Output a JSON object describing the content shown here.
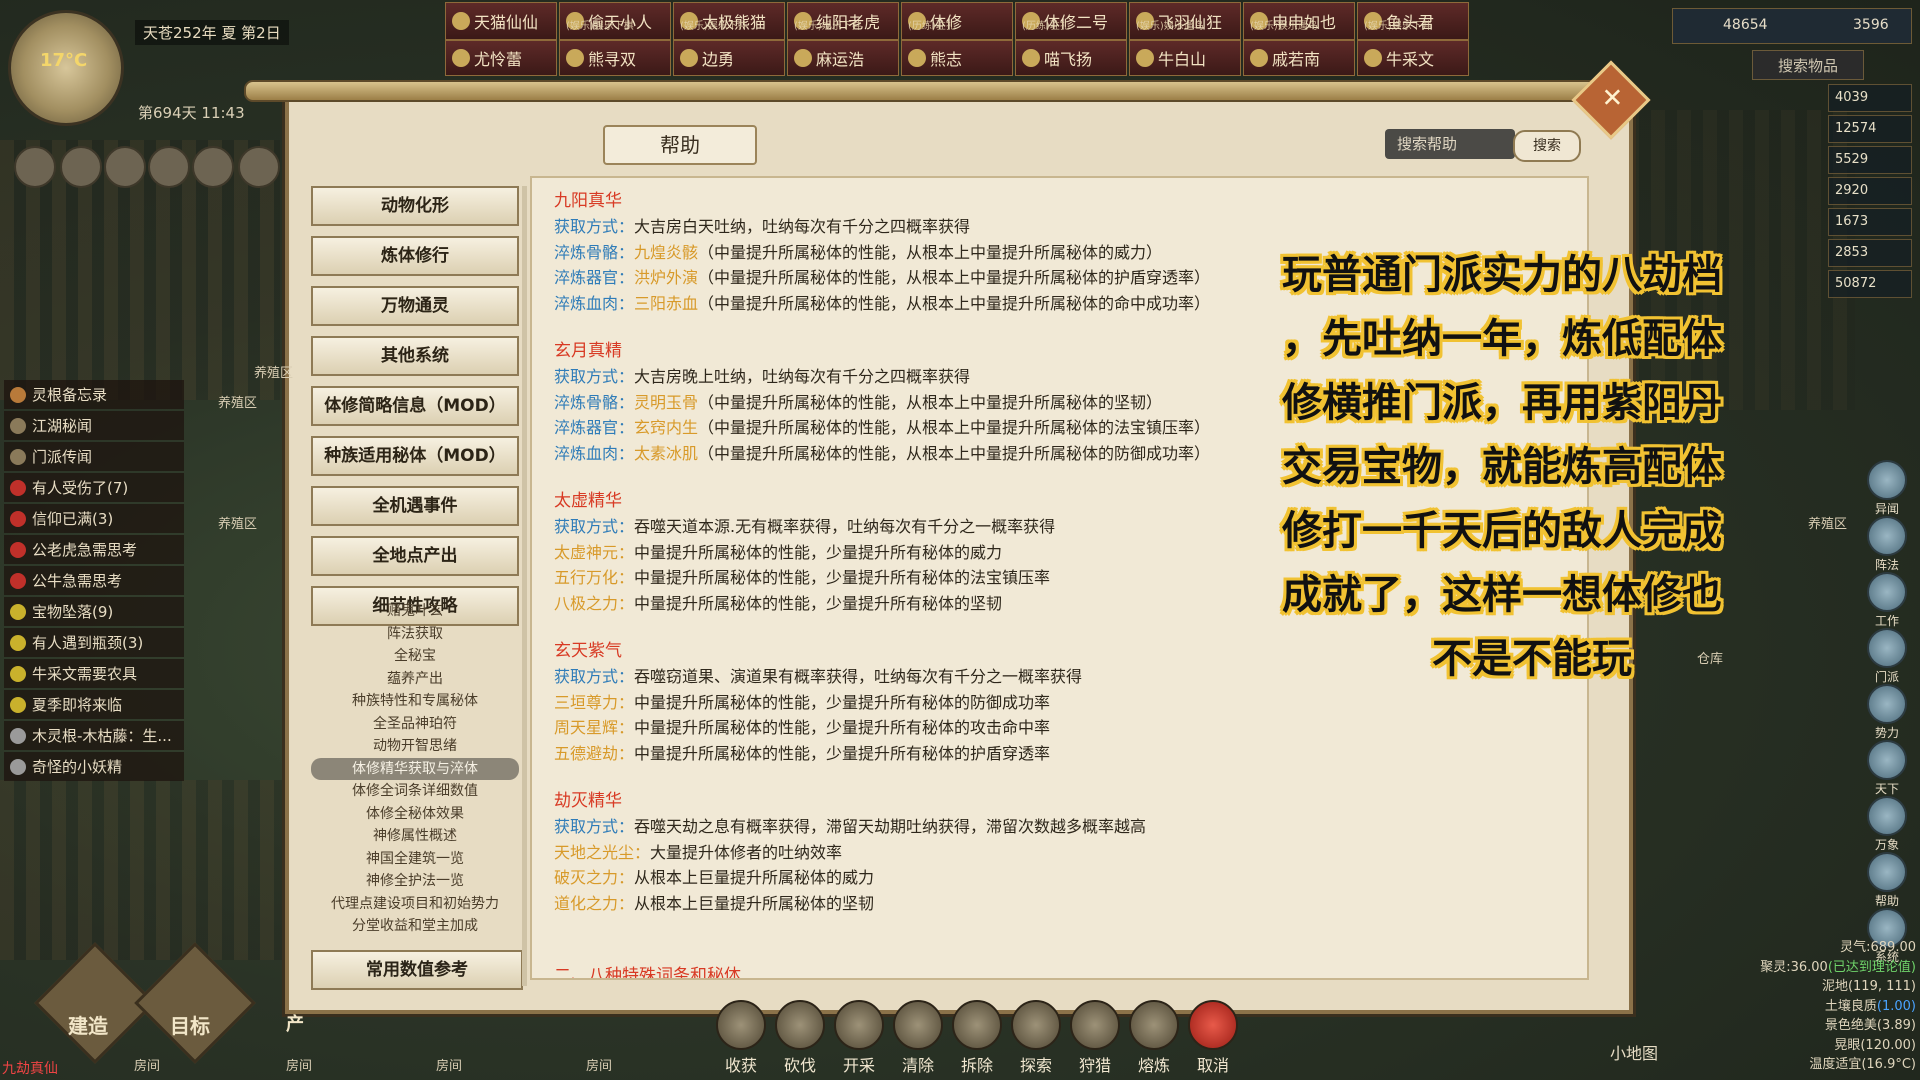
{
  "top": {
    "year_season": "天苍252年 夏 第2日",
    "temperature": "17°C",
    "day_time": "第694天 11:43",
    "npcs_row1": [
      {
        "name": "天猫仙仙",
        "sub": ""
      },
      {
        "name": "偷天小人",
        "sub": "(娱乐)娱乐下棋"
      },
      {
        "name": "太极熊猫",
        "sub": "(娱乐)娱乐下井"
      },
      {
        "name": "纯阳老虎",
        "sub": "(娱乐)娱乐下井"
      },
      {
        "name": "体修",
        "sub": "(历练)驻扎"
      },
      {
        "name": "体修二号",
        "sub": "(历练)驻扎"
      },
      {
        "name": "飞羽仙狂",
        "sub": "(娱乐)娱乐遛鸟"
      },
      {
        "name": "申申如也",
        "sub": "(娱乐)娱乐遛鸟"
      },
      {
        "name": "鱼头君",
        "sub": "(娱乐)娱乐下井"
      }
    ],
    "npcs_row2": [
      "尤怜蕾",
      "熊寻双",
      "边勇",
      "麻运浩",
      "熊志",
      "喵飞扬",
      "牛白山",
      "戚若南",
      "牛采文"
    ],
    "resources": {
      "spirit_stone": "48654",
      "food": "3596"
    },
    "search_items": "搜索物品",
    "res_values": [
      "4039",
      "12574",
      "5529",
      "2920",
      "1673",
      "2853",
      "50872"
    ]
  },
  "left_list": [
    {
      "label": "灵根备忘录",
      "dot": "#b87a3a"
    },
    {
      "label": "江湖秘闻",
      "dot": "#8a7a5a"
    },
    {
      "label": "门派传闻",
      "dot": "#8a7a5a"
    },
    {
      "label": "有人受伤了(7)",
      "dot": "#c0302a"
    },
    {
      "label": "信仰已满(3)",
      "dot": "#c0302a"
    },
    {
      "label": "公老虎急需思考",
      "dot": "#c0302a"
    },
    {
      "label": "公牛急需思考",
      "dot": "#c0302a"
    },
    {
      "label": "宝物坠落(9)",
      "dot": "#c9b12c"
    },
    {
      "label": "有人遇到瓶颈(3)",
      "dot": "#c9b12c"
    },
    {
      "label": "牛采文需要农具",
      "dot": "#c9b12c"
    },
    {
      "label": "夏季即将来临",
      "dot": "#c9b12c"
    },
    {
      "label": "木灵根-木枯藤：生...",
      "dot": "#9a9a9a"
    },
    {
      "label": "奇怪的小妖精",
      "dot": "#9a9a9a"
    }
  ],
  "panel": {
    "title": "帮助",
    "search_placeholder": "搜索帮助",
    "search_button": "搜索",
    "categories": [
      "动物化形",
      "炼体修行",
      "万物通灵",
      "其他系统",
      "体修简略信息（MOD）",
      "种族适用秘体（MOD）",
      "全机遇事件",
      "全地点产出",
      "细节性攻略"
    ],
    "subcategories": [
      "赌鬼叶玄",
      "阵法获取",
      "全秘宝",
      "蕴养产出",
      "种族特性和专属秘体",
      "全圣品神珀符",
      "动物开智思绪",
      "体修精华获取与淬体",
      "体修全词条详细数值",
      "体修全秘体效果",
      "神修属性概述",
      "神国全建筑一览",
      "神修全护法一览",
      "代理点建设项目和初始势力",
      "分堂收益和堂主加成"
    ],
    "active_sub_index": 7,
    "bottom_category": "常用数值参考",
    "sections": [
      {
        "title": "九阳真华",
        "rows": [
          {
            "k": "获取方式：",
            "o": "",
            "t": "大吉房白天吐纳，吐纳每次有千分之四概率获得"
          },
          {
            "k": "淬炼骨骼：",
            "o": "九煌炎骸",
            "t": "（中量提升所属秘体的性能，从根本上中量提升所属秘体的威力）"
          },
          {
            "k": "淬炼器官：",
            "o": "洪炉外演",
            "t": "（中量提升所属秘体的性能，从根本上中量提升所属秘体的护盾穿透率）"
          },
          {
            "k": "淬炼血肉：",
            "o": "三阳赤血",
            "t": "（中量提升所属秘体的性能，从根本上中量提升所属秘体的命中成功率）"
          }
        ]
      },
      {
        "title": "玄月真精",
        "rows": [
          {
            "k": "获取方式：",
            "o": "",
            "t": "大吉房晚上吐纳，吐纳每次有千分之四概率获得"
          },
          {
            "k": "淬炼骨骼：",
            "o": "灵明玉骨",
            "t": "（中量提升所属秘体的性能，从根本上中量提升所属秘体的坚韧）"
          },
          {
            "k": "淬炼器官：",
            "o": "玄窍内生",
            "t": "（中量提升所属秘体的性能，从根本上中量提升所属秘体的法宝镇压率）"
          },
          {
            "k": "淬炼血肉：",
            "o": "太素冰肌",
            "t": "（中量提升所属秘体的性能，从根本上中量提升所属秘体的防御成功率）"
          }
        ]
      },
      {
        "title": "太虚精华",
        "rows": [
          {
            "k": "获取方式：",
            "o": "",
            "t": "吞噬天道本源.无有概率获得，吐纳每次有千分之一概率获得"
          },
          {
            "k": "",
            "o": "太虚神元：",
            "t": "中量提升所属秘体的性能，少量提升所有秘体的威力"
          },
          {
            "k": "",
            "o": "五行万化：",
            "t": "中量提升所属秘体的性能，少量提升所有秘体的法宝镇压率"
          },
          {
            "k": "",
            "o": "八极之力：",
            "t": "中量提升所属秘体的性能，少量提升所有秘体的坚韧"
          }
        ]
      },
      {
        "title": "玄天紫气",
        "rows": [
          {
            "k": "获取方式：",
            "o": "",
            "t": "吞噬窃道果、演道果有概率获得，吐纳每次有千分之一概率获得"
          },
          {
            "k": "",
            "o": "三垣尊力：",
            "t": "中量提升所属秘体的性能，少量提升所有秘体的防御成功率"
          },
          {
            "k": "",
            "o": "周天星辉：",
            "t": "中量提升所属秘体的性能，少量提升所有秘体的攻击命中率"
          },
          {
            "k": "",
            "o": "五德避劫：",
            "t": "中量提升所属秘体的性能，少量提升所有秘体的护盾穿透率"
          }
        ]
      },
      {
        "title": "劫灭精华",
        "rows": [
          {
            "k": "获取方式：",
            "o": "",
            "t": "吞噬天劫之息有概率获得，滞留天劫期吐纳获得，滞留次数越多概率越高"
          },
          {
            "k": "",
            "o": "天地之光尘：",
            "t": "大量提升体修者的吐纳效率"
          },
          {
            "k": "",
            "o": "破灭之力：",
            "t": "从根本上巨量提升所属秘体的威力"
          },
          {
            "k": "",
            "o": "道化之力：",
            "t": "从根本上巨量提升所属秘体的坚韧"
          }
        ]
      }
    ],
    "cut_off_title": "二、八种特殊词条和秘体"
  },
  "overlay_lines": [
    "玩普通门派实力的八劫档",
    "，先吐纳一年，炼低配体",
    "修横推门派，再用紫阳丹",
    "交易宝物，就能炼高配体",
    "修打一千天后的敌人完成",
    "成就了，这样一想体修也",
    "不是不能玩"
  ],
  "right_menu": [
    "异闻",
    "阵法",
    "工作",
    "门派",
    "势力",
    "天下",
    "万象",
    "帮助",
    "系统"
  ],
  "stats": [
    {
      "t": "灵气:689.00",
      "c": ""
    },
    {
      "t": "聚灵:36.00",
      "extra": "(已达到理论值)",
      "c": "g"
    },
    {
      "t": "泥地(119, 111)",
      "c": ""
    },
    {
      "t": "土壤良质",
      "extra": "(1.00)",
      "c": "b"
    },
    {
      "t": "景色绝美(3.89)",
      "c": ""
    },
    {
      "t": "晃眼(120.00)",
      "c": ""
    },
    {
      "t": "温度适宜(16.9°C)",
      "c": ""
    }
  ],
  "bottom_tools": [
    "收获",
    "砍伐",
    "开采",
    "清除",
    "拆除",
    "探索",
    "狩猎",
    "熔炼",
    "取消"
  ],
  "bottom_left": {
    "build": "建造",
    "target": "目标",
    "produce": "产",
    "name_tag": "九劫真仙"
  },
  "minimap_label": "小地图",
  "map_labels": [
    "养殖区",
    "养殖区",
    "养殖区",
    "养殖区",
    "仓库",
    "房间",
    "房间",
    "房间",
    "房间"
  ]
}
